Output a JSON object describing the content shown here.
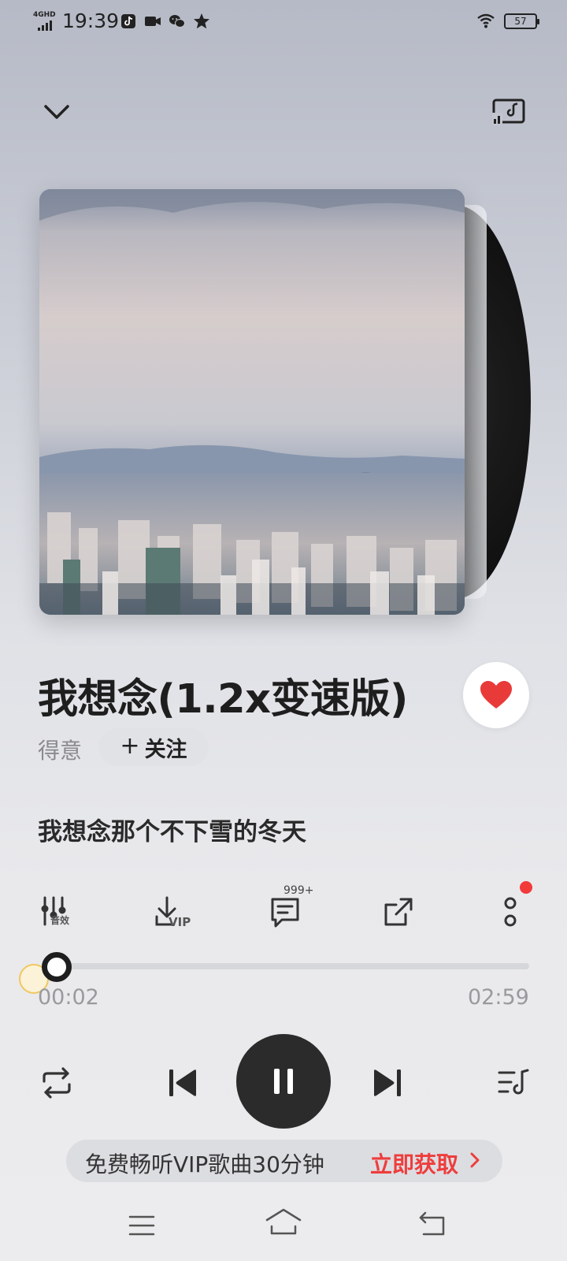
{
  "status_bar": {
    "network": "4GHD",
    "time": "19:39",
    "battery": "57",
    "notification_icons": [
      "tiktok-icon",
      "video-icon",
      "wechat-icon",
      "star-icon"
    ]
  },
  "track": {
    "title": "我想念(1.2x变速版)",
    "artist": "得意",
    "follow_label": "关注",
    "liked": true
  },
  "lyrics": {
    "current_line": "我想念那个不下雪的冬天"
  },
  "actions": {
    "effect_label": "音效",
    "download_label": "VIP",
    "comment_count": "999+"
  },
  "playback": {
    "current_time": "00:02",
    "total_time": "02:59",
    "progress": 0.011,
    "state": "playing"
  },
  "promo": {
    "text": "免费畅听VIP歌曲30分钟",
    "cta": "立即获取"
  },
  "colors": {
    "accent_red": "#ee3d3d",
    "like_red": "#e93a3a",
    "dark": "#2b2b2b"
  }
}
